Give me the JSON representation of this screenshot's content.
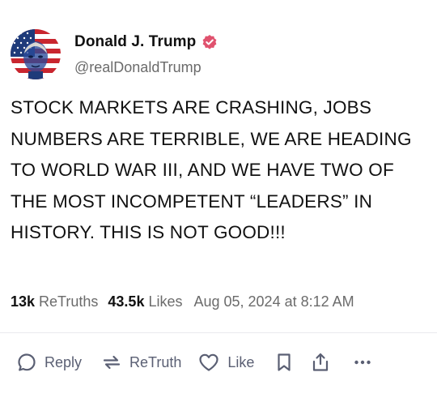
{
  "post": {
    "author": {
      "display_name": "Donald J. Trump",
      "handle": "@realDonaldTrump",
      "verified": true,
      "avatar_icon": "american-flag-portrait-avatar"
    },
    "text": "STOCK MARKETS ARE CRASHING, JOBS NUMBERS ARE TERRIBLE, WE ARE HEADING TO WORLD WAR III, AND WE HAVE TWO OF THE MOST INCOMPETENT “LEADERS” IN HISTORY. THIS IS NOT GOOD!!!",
    "stats": {
      "retruths_count": "13k",
      "retruths_label": "ReTruths",
      "likes_count": "43.5k",
      "likes_label": "Likes",
      "timestamp": "Aug 05, 2024 at 8:12 AM"
    }
  },
  "actions": {
    "reply_label": "Reply",
    "retruth_label": "ReTruth",
    "like_label": "Like",
    "icons": [
      "reply-icon",
      "retruth-icon",
      "like-icon",
      "bookmark-icon",
      "share-icon",
      "more-icon"
    ]
  },
  "colors": {
    "text": "#111111",
    "muted": "#6b6b6b",
    "action": "#5a5f73",
    "verified_badge": "#e0526e",
    "divider": "#e9e9ee"
  }
}
